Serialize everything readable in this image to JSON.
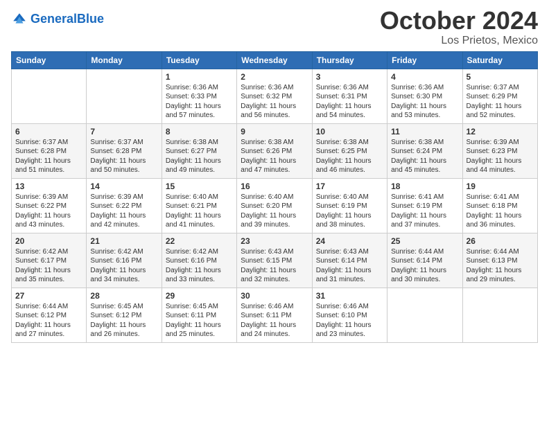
{
  "logo": {
    "text_general": "General",
    "text_blue": "Blue"
  },
  "header": {
    "month": "October 2024",
    "location": "Los Prietos, Mexico"
  },
  "weekdays": [
    "Sunday",
    "Monday",
    "Tuesday",
    "Wednesday",
    "Thursday",
    "Friday",
    "Saturday"
  ],
  "weeks": [
    [
      null,
      null,
      {
        "day": 1,
        "sunrise": "6:36 AM",
        "sunset": "6:33 PM",
        "daylight": "11 hours and 57 minutes."
      },
      {
        "day": 2,
        "sunrise": "6:36 AM",
        "sunset": "6:32 PM",
        "daylight": "11 hours and 56 minutes."
      },
      {
        "day": 3,
        "sunrise": "6:36 AM",
        "sunset": "6:31 PM",
        "daylight": "11 hours and 54 minutes."
      },
      {
        "day": 4,
        "sunrise": "6:36 AM",
        "sunset": "6:30 PM",
        "daylight": "11 hours and 53 minutes."
      },
      {
        "day": 5,
        "sunrise": "6:37 AM",
        "sunset": "6:29 PM",
        "daylight": "11 hours and 52 minutes."
      }
    ],
    [
      {
        "day": 6,
        "sunrise": "6:37 AM",
        "sunset": "6:28 PM",
        "daylight": "11 hours and 51 minutes."
      },
      {
        "day": 7,
        "sunrise": "6:37 AM",
        "sunset": "6:28 PM",
        "daylight": "11 hours and 50 minutes."
      },
      {
        "day": 8,
        "sunrise": "6:38 AM",
        "sunset": "6:27 PM",
        "daylight": "11 hours and 49 minutes."
      },
      {
        "day": 9,
        "sunrise": "6:38 AM",
        "sunset": "6:26 PM",
        "daylight": "11 hours and 47 minutes."
      },
      {
        "day": 10,
        "sunrise": "6:38 AM",
        "sunset": "6:25 PM",
        "daylight": "11 hours and 46 minutes."
      },
      {
        "day": 11,
        "sunrise": "6:38 AM",
        "sunset": "6:24 PM",
        "daylight": "11 hours and 45 minutes."
      },
      {
        "day": 12,
        "sunrise": "6:39 AM",
        "sunset": "6:23 PM",
        "daylight": "11 hours and 44 minutes."
      }
    ],
    [
      {
        "day": 13,
        "sunrise": "6:39 AM",
        "sunset": "6:22 PM",
        "daylight": "11 hours and 43 minutes."
      },
      {
        "day": 14,
        "sunrise": "6:39 AM",
        "sunset": "6:22 PM",
        "daylight": "11 hours and 42 minutes."
      },
      {
        "day": 15,
        "sunrise": "6:40 AM",
        "sunset": "6:21 PM",
        "daylight": "11 hours and 41 minutes."
      },
      {
        "day": 16,
        "sunrise": "6:40 AM",
        "sunset": "6:20 PM",
        "daylight": "11 hours and 39 minutes."
      },
      {
        "day": 17,
        "sunrise": "6:40 AM",
        "sunset": "6:19 PM",
        "daylight": "11 hours and 38 minutes."
      },
      {
        "day": 18,
        "sunrise": "6:41 AM",
        "sunset": "6:19 PM",
        "daylight": "11 hours and 37 minutes."
      },
      {
        "day": 19,
        "sunrise": "6:41 AM",
        "sunset": "6:18 PM",
        "daylight": "11 hours and 36 minutes."
      }
    ],
    [
      {
        "day": 20,
        "sunrise": "6:42 AM",
        "sunset": "6:17 PM",
        "daylight": "11 hours and 35 minutes."
      },
      {
        "day": 21,
        "sunrise": "6:42 AM",
        "sunset": "6:16 PM",
        "daylight": "11 hours and 34 minutes."
      },
      {
        "day": 22,
        "sunrise": "6:42 AM",
        "sunset": "6:16 PM",
        "daylight": "11 hours and 33 minutes."
      },
      {
        "day": 23,
        "sunrise": "6:43 AM",
        "sunset": "6:15 PM",
        "daylight": "11 hours and 32 minutes."
      },
      {
        "day": 24,
        "sunrise": "6:43 AM",
        "sunset": "6:14 PM",
        "daylight": "11 hours and 31 minutes."
      },
      {
        "day": 25,
        "sunrise": "6:44 AM",
        "sunset": "6:14 PM",
        "daylight": "11 hours and 30 minutes."
      },
      {
        "day": 26,
        "sunrise": "6:44 AM",
        "sunset": "6:13 PM",
        "daylight": "11 hours and 29 minutes."
      }
    ],
    [
      {
        "day": 27,
        "sunrise": "6:44 AM",
        "sunset": "6:12 PM",
        "daylight": "11 hours and 27 minutes."
      },
      {
        "day": 28,
        "sunrise": "6:45 AM",
        "sunset": "6:12 PM",
        "daylight": "11 hours and 26 minutes."
      },
      {
        "day": 29,
        "sunrise": "6:45 AM",
        "sunset": "6:11 PM",
        "daylight": "11 hours and 25 minutes."
      },
      {
        "day": 30,
        "sunrise": "6:46 AM",
        "sunset": "6:11 PM",
        "daylight": "11 hours and 24 minutes."
      },
      {
        "day": 31,
        "sunrise": "6:46 AM",
        "sunset": "6:10 PM",
        "daylight": "11 hours and 23 minutes."
      },
      null,
      null
    ]
  ]
}
